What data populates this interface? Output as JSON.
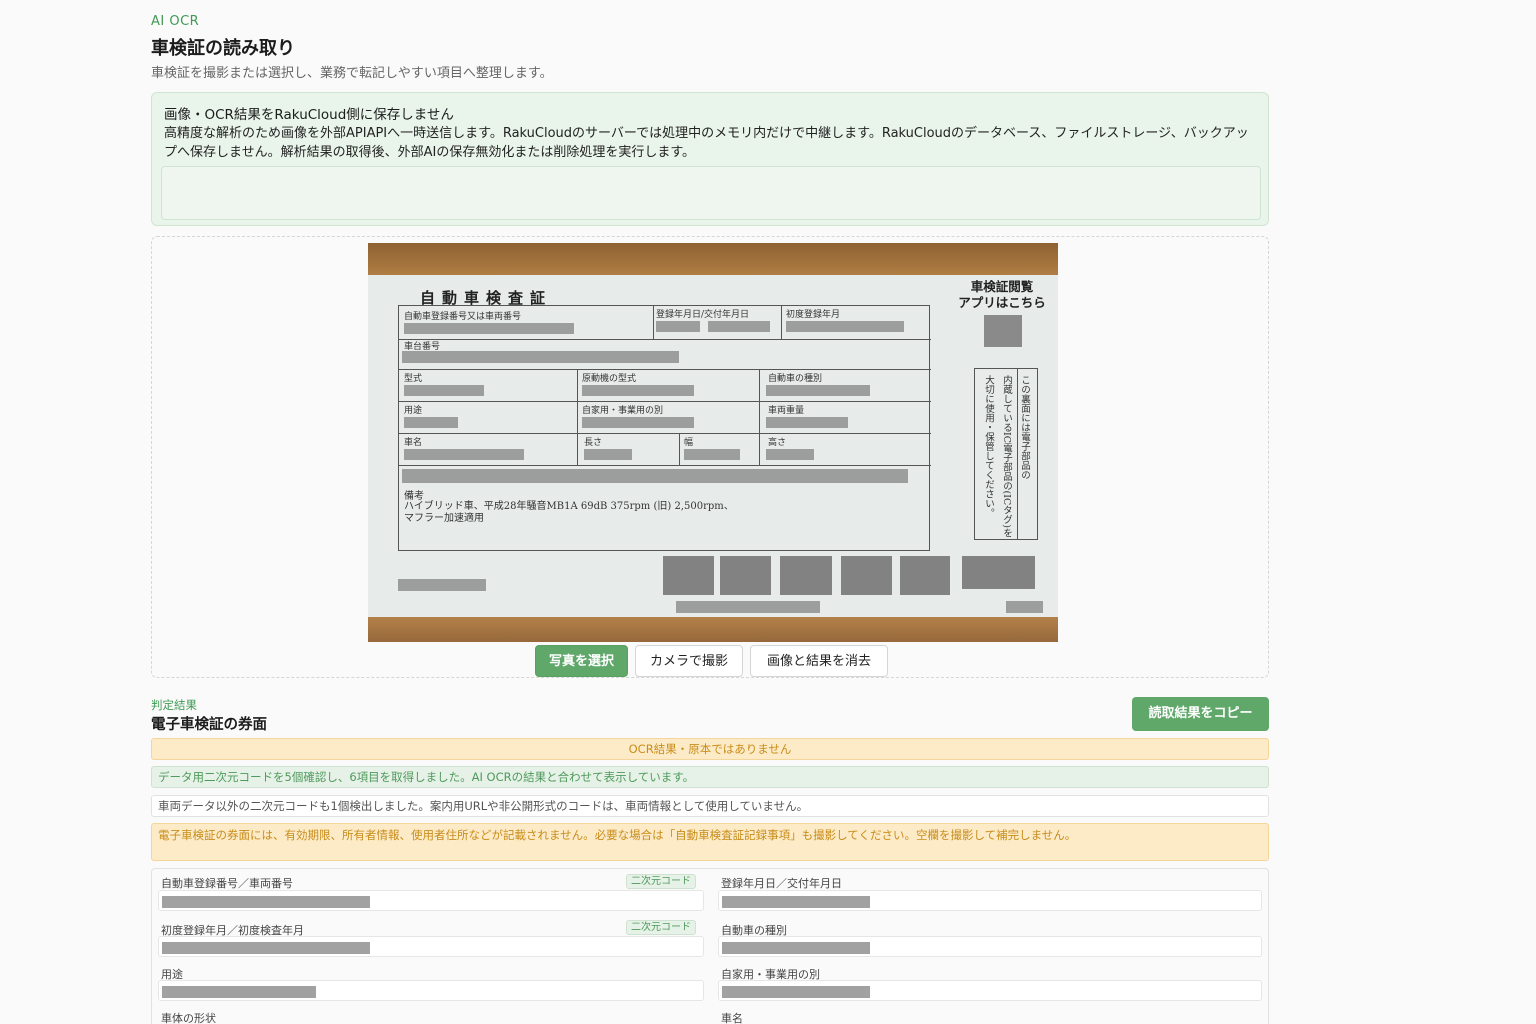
{
  "header": {
    "eyebrow": "AI OCR",
    "title": "車検証の読み取り",
    "subtitle": "車検証を撮影または選択し、業務で転記しやすい項目へ整理します。"
  },
  "notice": {
    "title": "画像・OCR結果をRakuCloud側に保存しません",
    "body": "高精度な解析のため画像を外部APIAPIへ一時送信します。RakuCloudのサーバーでは処理中のメモリ内だけで中継します。RakuCloudのデータベース、ファイルストレージ、バックアップへ保存しません。解析結果の取得後、外部AIの保存無効化または削除処理を実行します。"
  },
  "certificate": {
    "title": "自動車検査証",
    "labels": {
      "reg_no": "自動車登録番号又は車両番号",
      "reg_date": "登録年月日/交付年月日",
      "first_reg": "初度登録年月",
      "chassis": "車台番号",
      "model": "型式",
      "engine": "原動機の型式",
      "kind": "自動車の種別",
      "use": "用途",
      "private_business": "自家用・事業用の別",
      "weight": "車両重量",
      "name": "車名",
      "length": "長さ",
      "width": "幅",
      "height": "高さ",
      "remarks": "備考"
    },
    "remarks_text_1": "ハイブリッド車、平成28年騒音MB1A 69dB 375rpm (旧) 2,500rpm、",
    "remarks_text_2": "マフラー加速適用",
    "app_label_1": "車検証閲覧",
    "app_label_2": "アプリはこちら",
    "vertical_1": "この裏面には電子部品の",
    "vertical_2": "内蔵しているIC電子部品の(ICタグ)を",
    "vertical_3": "大切に使用・保管してください。"
  },
  "buttons": {
    "select_photo": "写真を選択",
    "camera": "カメラで撮影",
    "clear": "画像と結果を消去",
    "copy": "読取結果をコピー"
  },
  "result": {
    "eyebrow": "判定結果",
    "title": "電子車検証の券面",
    "warning": "OCR結果・原本ではありません",
    "success": "データ用二次元コードを5個確認し、6項目を取得しました。AI OCRの結果と合わせて表示しています。",
    "info": "車両データ以外の二次元コードも1個検出しました。案内用URLや非公開形式のコードは、車両情報として使用していません。",
    "note": "電子車検証の券面には、有効期限、所有者情報、使用者住所などが記載されません。必要な場合は「自動車検査証記録事項」も撮影してください。空欄を撮影して補完しません。"
  },
  "fields": {
    "badge": "二次元コード",
    "reg_no": "自動車登録番号／車両番号",
    "reg_date": "登録年月日／交付年月日",
    "first_reg": "初度登録年月／初度検査年月",
    "kind": "自動車の種別",
    "use": "用途",
    "private_business": "自家用・事業用の別",
    "body_shape": "車体の形状",
    "name": "車名"
  }
}
